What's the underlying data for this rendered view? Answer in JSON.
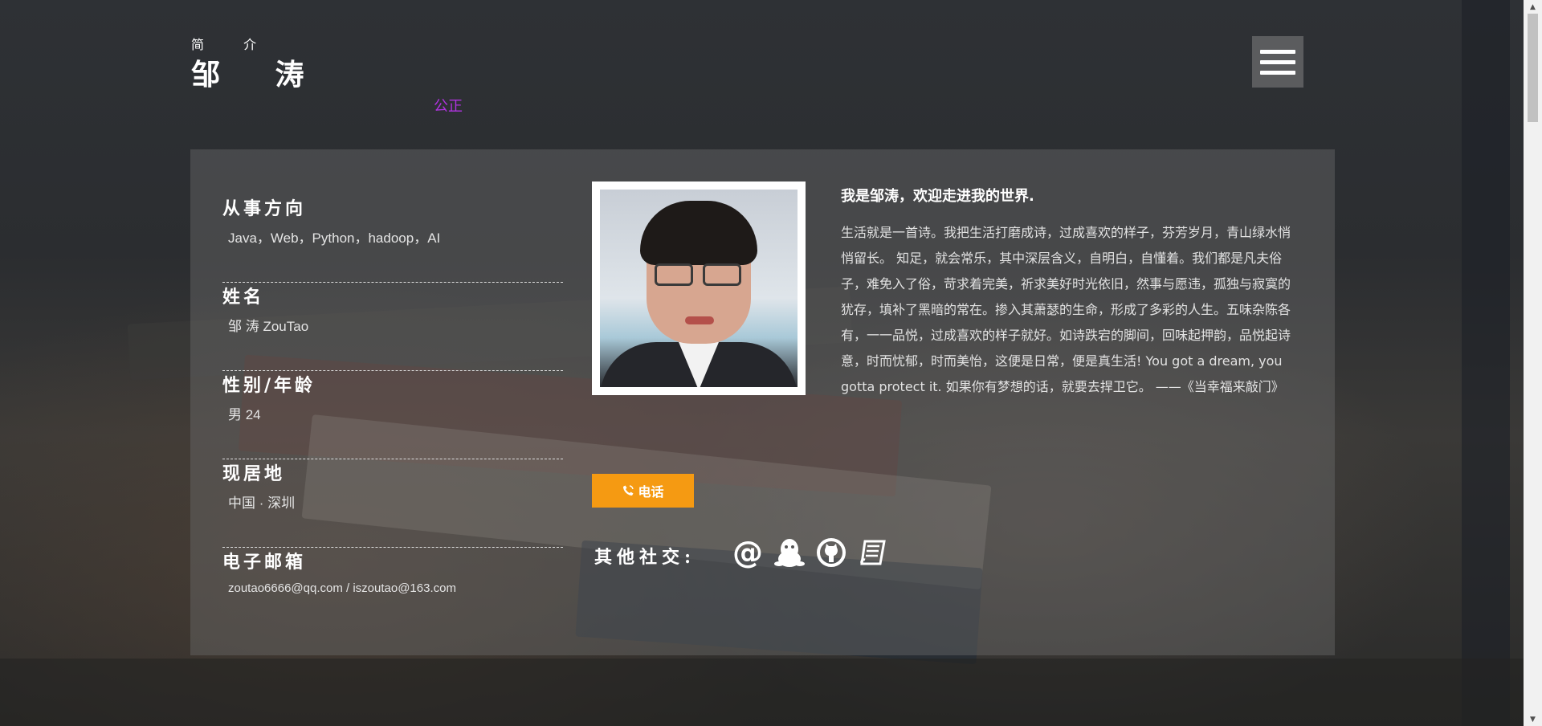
{
  "header": {
    "subtitle": "简 介",
    "name": "邹 涛",
    "motto": "公正"
  },
  "menu": {
    "icon": "hamburger-menu-icon"
  },
  "info": {
    "items": [
      {
        "title": "从事方向",
        "value": "Java，Web，Python，hadoop，AI"
      },
      {
        "title": "姓名",
        "value": "邹 涛 ZouTao"
      },
      {
        "title": "性别/年龄",
        "value": "男 24"
      },
      {
        "title": "现居地",
        "value": "中国 · 深圳"
      },
      {
        "title": "电子邮箱",
        "value": "zoutao6666@qq.com / iszoutao@163.com"
      }
    ]
  },
  "intro": {
    "title": "我是邹涛，欢迎走进我的世界.",
    "text": "生活就是一首诗。我把生活打磨成诗，过成喜欢的样子，芬芳岁月，青山绿水悄悄留长。 知足，就会常乐，其中深层含义，自明白，自懂着。我们都是凡夫俗子，难免入了俗，苛求着完美，祈求美好时光依旧，然事与愿违，孤独与寂寞的犹存，填补了黑暗的常在。掺入其萧瑟的生命，形成了多彩的人生。五味杂陈各有，一一品悦，过成喜欢的样子就好。如诗跌宕的脚间，回味起押韵，品悦起诗意，时而忧郁，时而美怡，这便是日常，便是真生活! You got a dream, you gotta protect it. 如果你有梦想的话，就要去捍卫它。 ——《当幸福来敲门》"
  },
  "phone_button": {
    "label": "电话",
    "icon": "phone-icon"
  },
  "social": {
    "label": "其他社交:",
    "icons": [
      "at-email-icon",
      "qq-penguin-icon",
      "github-icon",
      "book-blog-icon"
    ]
  },
  "colors": {
    "accent": "#f59a12",
    "motto": "#b033e0",
    "panel": "rgba(110,110,110,0.42)"
  }
}
